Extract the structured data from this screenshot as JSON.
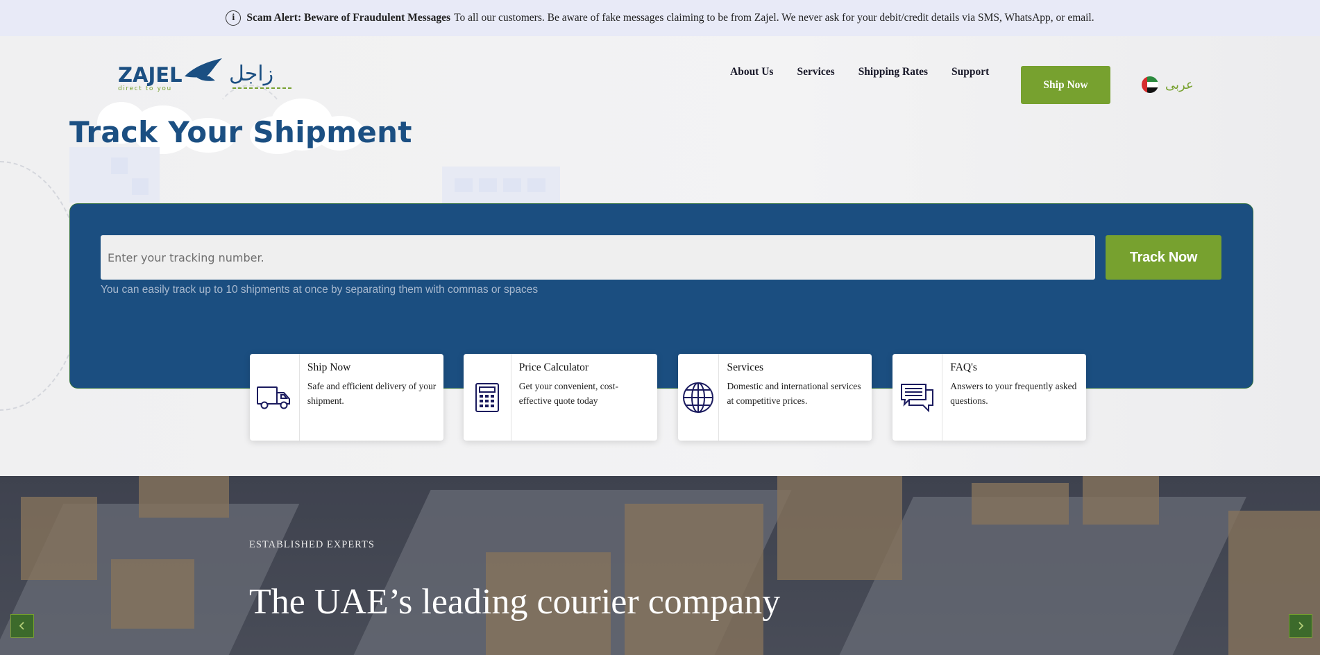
{
  "alert": {
    "heading": "Scam Alert: Beware of Fraudulent Messages",
    "message": "To all our customers. Be aware of fake messages claiming to be from Zajel. We never ask for your debit/credit details via SMS, WhatsApp, or email.",
    "icon": "info-circle-icon"
  },
  "logo": {
    "latin": "ZAJEL",
    "arabic": "زاجل",
    "tagline": "direct to you",
    "brand_color": "#1b4f82"
  },
  "nav": {
    "items": [
      {
        "label": "About Us"
      },
      {
        "label": "Services"
      },
      {
        "label": "Shipping Rates"
      },
      {
        "label": "Support"
      }
    ],
    "cta_label": "Ship Now",
    "language_label": "عربى"
  },
  "page_title": "Track Your Shipment",
  "tracking": {
    "placeholder": "Enter your tracking number.",
    "button_label": "Track Now",
    "hint": "You can easily track up to 10 shipments at once by separating them with commas or spaces"
  },
  "cards": [
    {
      "title": "Ship Now",
      "description": "Safe and efficient delivery of your shipment.",
      "icon": "truck-icon"
    },
    {
      "title": "Price Calculator",
      "description": "Get your convenient, cost-effective quote today",
      "icon": "calculator-icon"
    },
    {
      "title": "Services",
      "description": "Domestic and international services at competitive prices.",
      "icon": "globe-icon"
    },
    {
      "title": "FAQ's",
      "description": "Answers to your frequently asked questions.",
      "icon": "chat-bubbles-icon"
    }
  ],
  "banner": {
    "eyebrow": "ESTABLISHED EXPERTS",
    "headline": "The UAE’s leading courier company",
    "prev_icon": "chevron-left-icon",
    "next_icon": "chevron-right-icon"
  },
  "colors": {
    "accent_green": "#77a12f",
    "navy": "#1b4e80",
    "alert_bg": "#e8eaf7"
  }
}
